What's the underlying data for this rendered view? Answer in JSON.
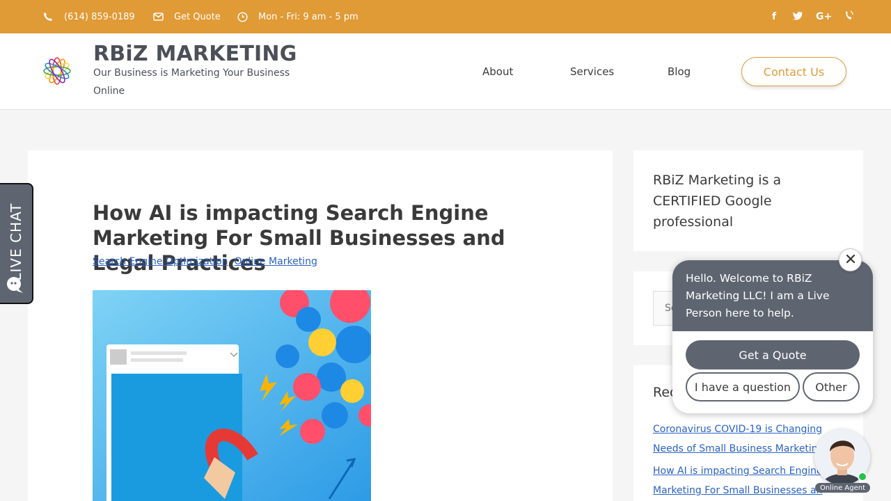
{
  "topbar": {
    "phone": "(614) 859-0189",
    "quote": "Get Quote",
    "hours": "Mon - Fri: 9 am - 5 pm",
    "social": [
      "f",
      "t",
      "G+",
      "phone"
    ]
  },
  "header": {
    "title": "RBiZ MARKETING",
    "tagline": "Our Business is Marketing Your Business Online",
    "nav": [
      "About",
      "Services",
      "Blog"
    ],
    "contact": "Contact Us"
  },
  "post": {
    "title": "How AI is impacting Search Engine Marketing For Small Businesses and Legal Practices",
    "categories": [
      "Search Engine Optimization",
      "Online Marketing"
    ],
    "separator": ","
  },
  "sidebar": {
    "cert": "RBiZ Marketing is a CERTIFIED Google professional",
    "search_placeholder": "Se",
    "recent_heading": "Rec",
    "recent_posts": [
      "Coronavirus COVID-19 is Changing Needs of Small Business Marketing",
      "How AI is impacting Search Engine Marketing For Small Businesses an"
    ]
  },
  "live_chat": {
    "label": "LIVE CHAT"
  },
  "chat": {
    "message": "Hello. Welcome to RBiZ Marketing LLC! I am a Live Person here to help.",
    "primary": "Get a Quote",
    "option1": "I have a question",
    "option2": "Other",
    "agent_label": "Online Agent"
  },
  "colors": {
    "accent": "#e09a36",
    "link": "#2a62c7",
    "chat": "#5f6570"
  }
}
